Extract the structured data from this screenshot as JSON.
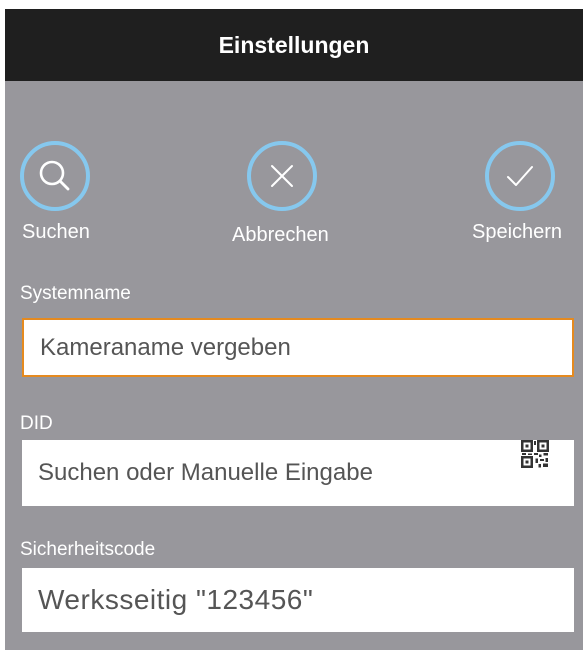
{
  "header": {
    "title": "Einstellungen"
  },
  "actions": {
    "search_label": "Suchen",
    "cancel_label": "Abbrechen",
    "save_label": "Speichern"
  },
  "fields": {
    "system_name": {
      "label": "Systemname",
      "placeholder": "Kameraname vergeben"
    },
    "did": {
      "label": "DID",
      "placeholder": "Suchen oder Manuelle Eingabe"
    },
    "security_code": {
      "label": "Sicherheitscode",
      "placeholder": "Werksseitig \"123456\""
    }
  },
  "colors": {
    "accent": "#86c8ee",
    "focus_border": "#e58a1f",
    "panel": "#98979c",
    "header": "#1f1f1f"
  },
  "icons": {
    "search": "search-icon",
    "cancel": "close-icon",
    "save": "check-icon",
    "qr": "qr-code-icon"
  }
}
